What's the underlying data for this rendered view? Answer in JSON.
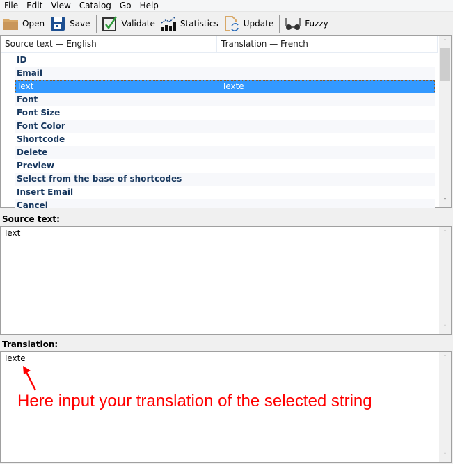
{
  "menubar": {
    "items": [
      "File",
      "Edit",
      "View",
      "Catalog",
      "Go",
      "Help"
    ]
  },
  "toolbar": {
    "buttons": [
      {
        "label": "Open",
        "icon": "folder-icon"
      },
      {
        "label": "Save",
        "icon": "floppy-disk-icon"
      },
      {
        "label": "Validate",
        "icon": "checkbox-check-icon"
      },
      {
        "label": "Statistics",
        "icon": "bar-chart-icon"
      },
      {
        "label": "Update",
        "icon": "document-refresh-icon"
      },
      {
        "label": "Fuzzy",
        "icon": "glasses-icon"
      }
    ]
  },
  "list": {
    "columns": [
      "Source text — English",
      "Translation — French"
    ],
    "rows": [
      {
        "source": "ID",
        "translation": ""
      },
      {
        "source": "Email",
        "translation": ""
      },
      {
        "source": "Text",
        "translation": "Texte",
        "selected": true
      },
      {
        "source": "Font",
        "translation": ""
      },
      {
        "source": "Font Size",
        "translation": ""
      },
      {
        "source": "Font Color",
        "translation": ""
      },
      {
        "source": "Shortcode",
        "translation": ""
      },
      {
        "source": "Delete",
        "translation": ""
      },
      {
        "source": "Preview",
        "translation": ""
      },
      {
        "source": "Select from the base of shortcodes",
        "translation": ""
      },
      {
        "source": "Insert Email",
        "translation": ""
      },
      {
        "source": "Cancel",
        "translation": ""
      }
    ]
  },
  "source_pane": {
    "label": "Source text:",
    "value": "Text"
  },
  "translation_pane": {
    "label": "Translation:",
    "value": "Texte"
  },
  "annotation": {
    "text": "Here input your translation of the selected string",
    "color": "#ff0000"
  },
  "colors": {
    "selection": "#3399ff",
    "row_text": "#17375e"
  }
}
